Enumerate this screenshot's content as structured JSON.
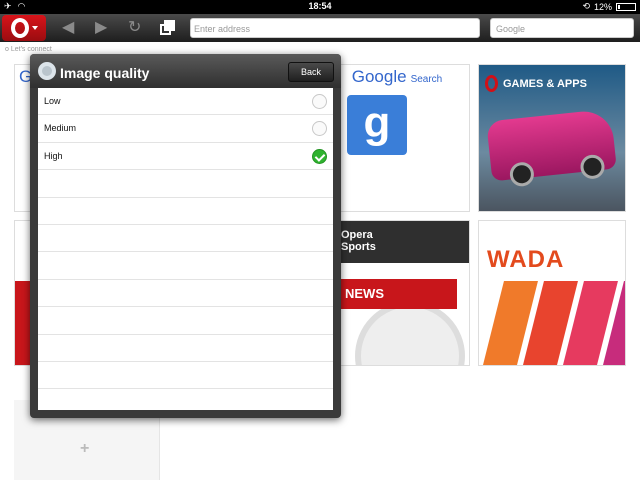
{
  "status_bar": {
    "time": "18:54",
    "battery": "12%",
    "battery_level": 0.12
  },
  "toolbar": {
    "address_placeholder": "Enter address",
    "search_placeholder": "Google"
  },
  "page": {
    "connect_text": "Let's connect",
    "tiles": {
      "google_logo": "Google",
      "google_search": "Search",
      "google_icon": "g",
      "games_title": "GAMES & APPS",
      "sports_line1": "Opera",
      "sports_line2": "Sports",
      "sports_news": "NEWS",
      "wada": "WADA",
      "add": "+"
    }
  },
  "popover": {
    "title": "Image quality",
    "back_label": "Back",
    "options": [
      {
        "label": "Low",
        "selected": false
      },
      {
        "label": "Medium",
        "selected": false
      },
      {
        "label": "High",
        "selected": true
      }
    ]
  },
  "colors": {
    "opera_red": "#d8141a",
    "check_green": "#2fb32f",
    "google_blue": "#3a7ed8",
    "wada_orange": "#e34a1d"
  }
}
